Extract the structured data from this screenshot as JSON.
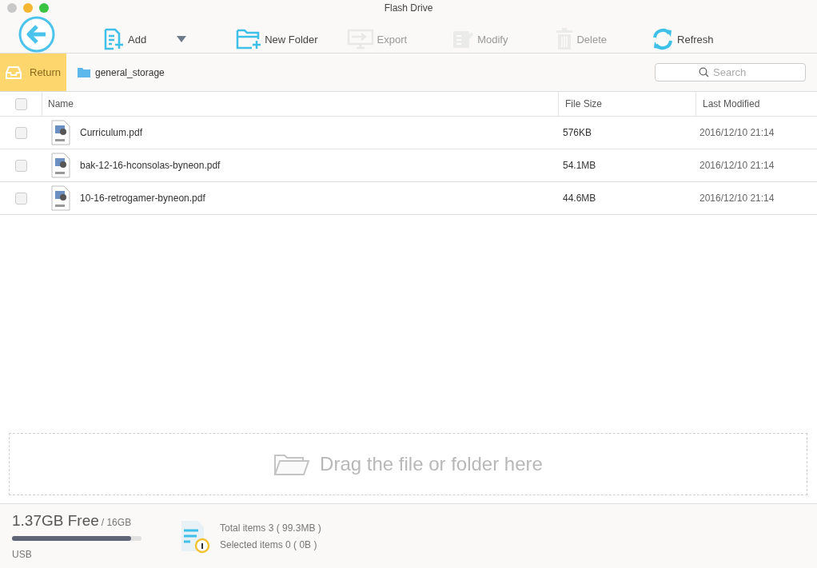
{
  "window": {
    "title": "Flash Drive"
  },
  "toolbar": [
    {
      "kind": "back",
      "disabled": false
    },
    {
      "kind": "add",
      "label": "Add",
      "disabled": false
    },
    {
      "kind": "dropdown",
      "disabled": false
    },
    {
      "kind": "new-folder",
      "label": "New Folder",
      "disabled": false
    },
    {
      "kind": "export",
      "label": "Export",
      "disabled": true
    },
    {
      "kind": "modify",
      "label": "Modify",
      "disabled": true
    },
    {
      "kind": "delete",
      "label": "Delete",
      "disabled": true
    },
    {
      "kind": "refresh",
      "label": "Refresh",
      "disabled": false
    }
  ],
  "breadcrumb": {
    "return_label": "Return",
    "folder": "general_storage"
  },
  "search": {
    "placeholder": "Search"
  },
  "table": {
    "select_all_checked": false,
    "columns": [
      "Name",
      "File Size",
      "Last Modified"
    ],
    "rows": [
      {
        "name": "Curriculum.pdf",
        "size": "576KB",
        "modified": "2016/12/10  21:14",
        "checked": false
      },
      {
        "name": "bak-12-16-hconsolas-byneon.pdf",
        "size": "54.1MB",
        "modified": "2016/12/10  21:14",
        "checked": false
      },
      {
        "name": "10-16-retrogamer-byneon.pdf",
        "size": "44.6MB",
        "modified": "2016/12/10  21:14",
        "checked": false
      }
    ]
  },
  "drop_zone": {
    "text": "Drag the file or folder here"
  },
  "footer": {
    "free": "1.37GB Free",
    "total": "/ 16GB",
    "level": 0.92,
    "device": "USB",
    "total_items": "Total items 3 ( 99.3MB )",
    "selected_items": "Selected items 0 ( 0B )"
  }
}
